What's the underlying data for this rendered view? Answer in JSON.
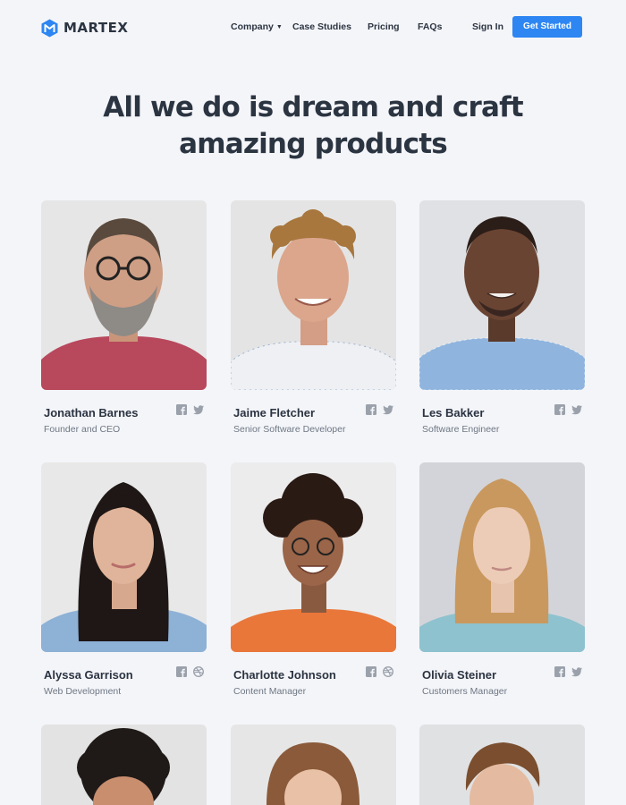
{
  "brand": {
    "name": "MARTEX"
  },
  "nav": {
    "items": [
      {
        "label": "Company",
        "has_dropdown": true
      },
      {
        "label": "Case Studies"
      },
      {
        "label": "Pricing"
      },
      {
        "label": "FAQs"
      },
      {
        "label": "Sign In"
      }
    ],
    "cta_label": "Get Started"
  },
  "hero": {
    "title_line1": "All we do is dream and craft",
    "title_line2": "amazing products"
  },
  "team": [
    {
      "name": "Jonathan Barnes",
      "role": "Founder and CEO",
      "socials": [
        "facebook-icon",
        "twitter-icon"
      ]
    },
    {
      "name": "Jaime Fletcher",
      "role": "Senior Software Developer",
      "socials": [
        "facebook-icon",
        "twitter-icon"
      ]
    },
    {
      "name": "Les Bakker",
      "role": "Software Engineer",
      "socials": [
        "facebook-icon",
        "twitter-icon"
      ]
    },
    {
      "name": "Alyssa Garrison",
      "role": "Web Development",
      "socials": [
        "facebook-icon",
        "dribbble-icon"
      ]
    },
    {
      "name": "Charlotte Johnson",
      "role": "Content Manager",
      "socials": [
        "facebook-icon",
        "dribbble-icon"
      ]
    },
    {
      "name": "Olivia Steiner",
      "role": "Customers Manager",
      "socials": [
        "facebook-icon",
        "twitter-icon"
      ]
    }
  ],
  "colors": {
    "background": "#f4f5f9",
    "text": "#2b3441",
    "muted": "#6e7784",
    "accent": "#2d86f2",
    "icon": "#9aa1ab"
  }
}
